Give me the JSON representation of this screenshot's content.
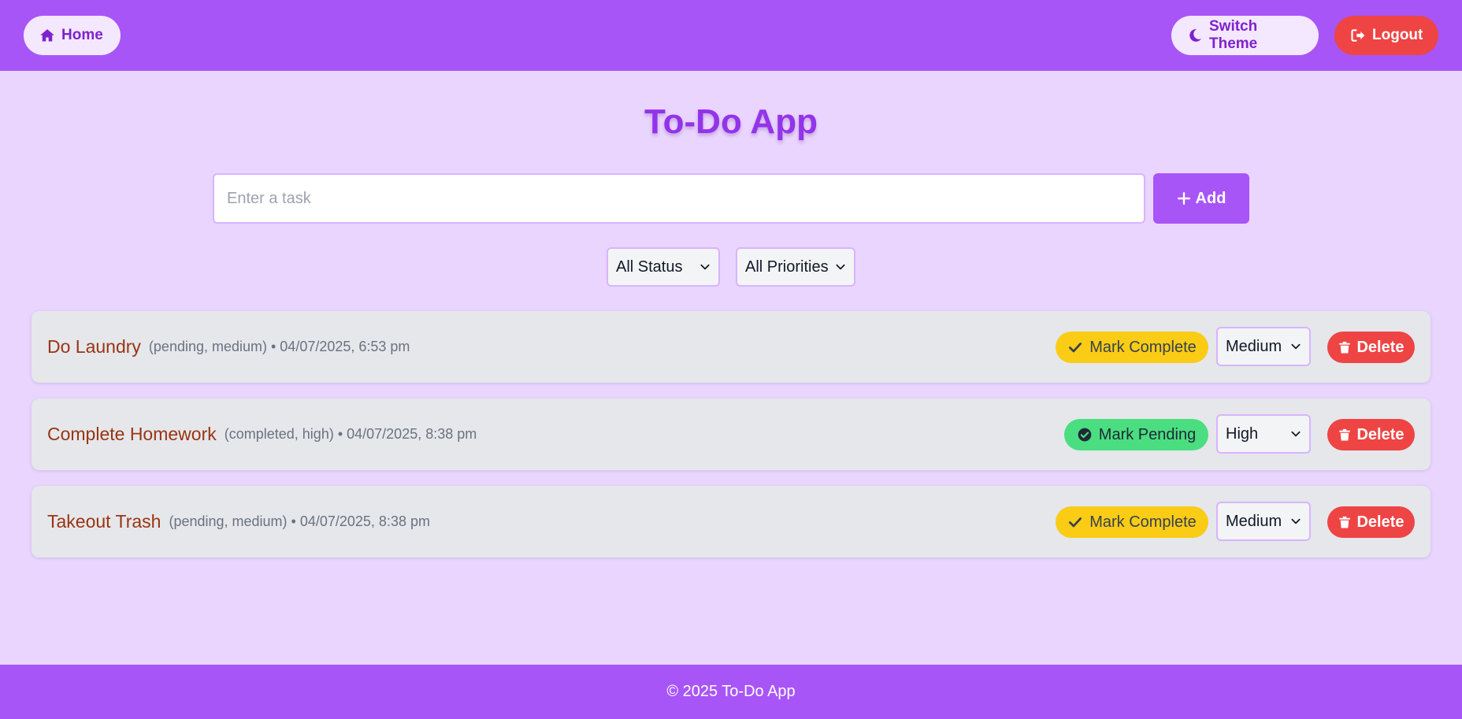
{
  "header": {
    "home_label": "Home",
    "home_icon": "home-icon",
    "theme_label": "Switch Theme",
    "theme_icon": "moon-icon",
    "logout_label": "Logout",
    "logout_icon": "sign-out-icon"
  },
  "title": "To-Do App",
  "add_form": {
    "placeholder": "Enter a task",
    "value": "",
    "add_label": "Add",
    "add_icon": "plus-icon"
  },
  "filters": {
    "status": "All Status",
    "priority": "All Priorities"
  },
  "tasks": [
    {
      "name": "Do Laundry",
      "meta": "(pending, medium) • 04/07/2025, 6:53 pm",
      "toggle_label": "Mark Complete",
      "toggle_icon": "check-icon",
      "priority": "Medium",
      "delete_label": "Delete"
    },
    {
      "name": "Complete Homework",
      "meta": "(completed, high) • 04/07/2025, 8:38 pm",
      "toggle_label": "Mark Pending",
      "toggle_icon": "check-circle-icon",
      "priority": "High",
      "delete_label": "Delete"
    },
    {
      "name": "Takeout Trash",
      "meta": "(pending, medium) • 04/07/2025, 8:38 pm",
      "toggle_label": "Mark Complete",
      "toggle_icon": "check-icon",
      "priority": "Medium",
      "delete_label": "Delete"
    }
  ],
  "footer": "© 2025 To-Do App",
  "colors": {
    "primary": "#a855f7",
    "page_background": "#e9d5ff",
    "danger": "#ef4444",
    "warning": "#facc15",
    "success": "#4ade80",
    "task_name": "#9a3412"
  }
}
